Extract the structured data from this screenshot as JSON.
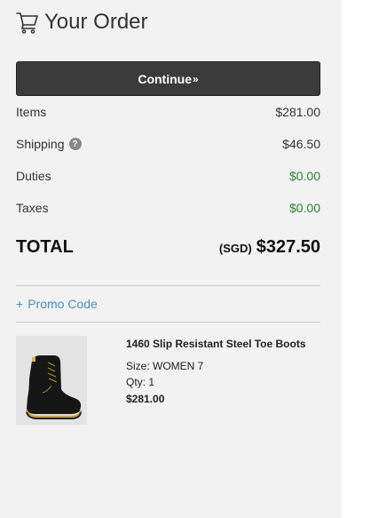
{
  "header": {
    "title": "Your Order",
    "icon": "cart-icon"
  },
  "continue_button": {
    "label": "Continue",
    "chevron": "»"
  },
  "summary": {
    "items": {
      "label": "Items",
      "value": "$281.00"
    },
    "shipping": {
      "label": "Shipping",
      "help": "?",
      "value": "$46.50"
    },
    "duties": {
      "label": "Duties",
      "value": "$0.00"
    },
    "taxes": {
      "label": "Taxes",
      "value": "$0.00"
    }
  },
  "total": {
    "label": "TOTAL",
    "currency": "(SGD)",
    "value": "$327.50"
  },
  "promo": {
    "plus": "+",
    "label": "Promo Code"
  },
  "product": {
    "name": "1460 Slip Resistant Steel Toe Boots",
    "size": "Size: WOMEN 7",
    "qty": "Qty: 1",
    "price": "$281.00",
    "image": "boot-image"
  },
  "colors": {
    "panel_bg": "#f2f2f2",
    "button_bg": "#3b3b3b",
    "green": "#2e7d32",
    "link": "#4a90b8"
  }
}
